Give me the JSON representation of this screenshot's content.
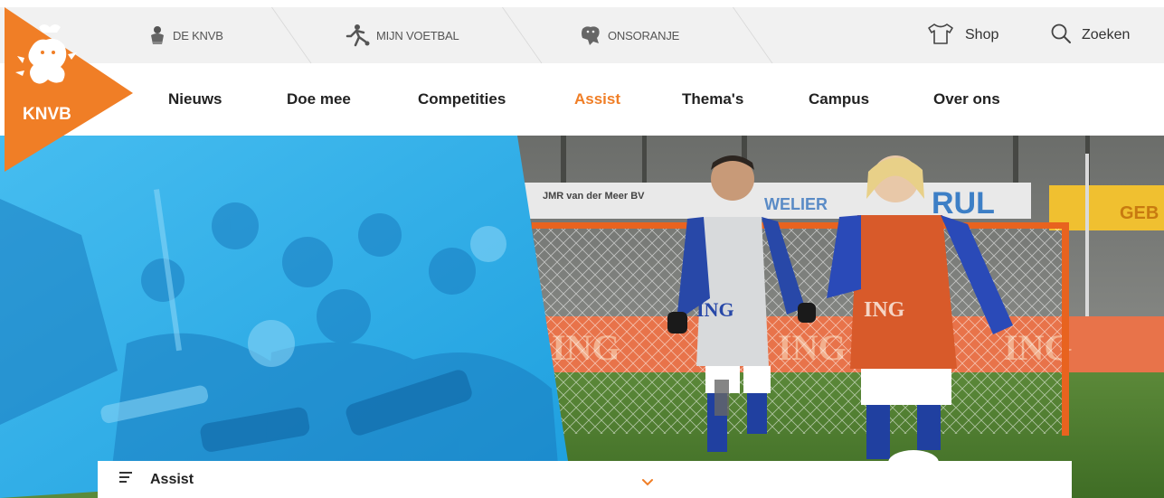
{
  "top_links": [
    {
      "label": "DE KNVB",
      "icon": "knvb-crest-icon"
    },
    {
      "label": "MIJN VOETBAL",
      "icon": "player-kick-icon"
    },
    {
      "label": "ONSORANJE",
      "icon": "lion-icon"
    }
  ],
  "top_right": {
    "shop_label": "Shop",
    "search_label": "Zoeken"
  },
  "logo": {
    "text": "KNVB",
    "color": "#f07e26"
  },
  "nav": [
    {
      "label": "Nieuws"
    },
    {
      "label": "Doe mee"
    },
    {
      "label": "Competities"
    },
    {
      "label": "Assist",
      "active": true
    },
    {
      "label": "Thema's"
    },
    {
      "label": "Campus"
    },
    {
      "label": "Over ons"
    }
  ],
  "hero": {
    "banner_text": "JMR van der Meer BV",
    "sponsor": "ING",
    "sponsor2": "WELIER",
    "sponsor3": "GEB"
  },
  "subnav": {
    "label": "Assist"
  },
  "colors": {
    "accent": "#f07e26",
    "topbar_bg": "#f1f1f1",
    "overlay_blue": "#38b3e8"
  }
}
